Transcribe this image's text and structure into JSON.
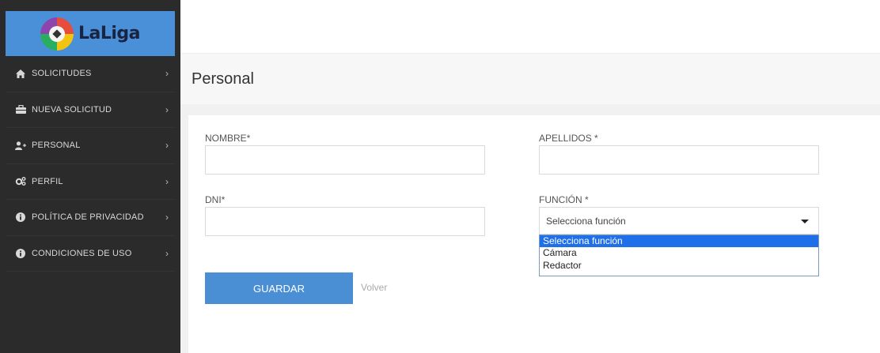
{
  "brand": {
    "name": "LaLiga"
  },
  "sidebar": {
    "items": [
      {
        "label": "SOLICITUDES",
        "icon": "home-icon"
      },
      {
        "label": "NUEVA SOLICITUD",
        "icon": "briefcase-icon"
      },
      {
        "label": "PERSONAL",
        "icon": "user-add-icon"
      },
      {
        "label": "PERFIL",
        "icon": "gears-icon"
      },
      {
        "label": "POLÍTICA DE PRIVACIDAD",
        "icon": "info-circle-icon"
      },
      {
        "label": "CONDICIONES DE USO",
        "icon": "info-circle-icon"
      }
    ]
  },
  "page": {
    "title": "Personal"
  },
  "form": {
    "nombre_label": "NOMBRE*",
    "nombre_value": "",
    "apellidos_label": "APELLIDOS *",
    "apellidos_value": "",
    "dni_label": "DNI*",
    "dni_value": "",
    "funcion_label": "FUNCIÓN *",
    "funcion_selected": "Selecciona función",
    "funcion_options": [
      "Selecciona función",
      "Cámara",
      "Redactor"
    ],
    "save_label": "GUARDAR",
    "back_label": "Volver"
  },
  "colors": {
    "sidebar_bg": "#2b2b2b",
    "logo_bg": "#4a90d9",
    "button_bg": "#4a8fd4",
    "option_highlight": "#1e6fe8"
  }
}
